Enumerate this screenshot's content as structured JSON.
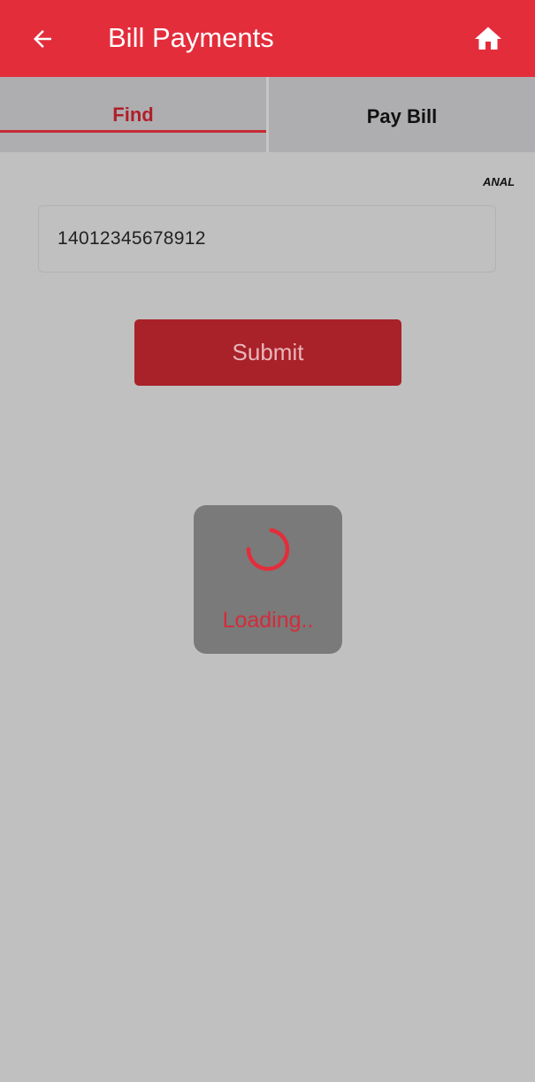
{
  "header": {
    "title": "Bill Payments",
    "back_icon": "arrow-left-icon",
    "home_icon": "home-icon"
  },
  "tabs": [
    {
      "label": "Find",
      "active": true
    },
    {
      "label": "Pay Bill",
      "active": false
    }
  ],
  "corner_text": "ANAL",
  "form": {
    "input_value": "14012345678912",
    "submit_label": "Submit"
  },
  "loading": {
    "text": "Loading..",
    "icon": "spinner-icon"
  },
  "colors": {
    "brand": "#e32d3b",
    "accent": "#b01f2a",
    "button": "#a92129",
    "background": "#c0c0c0",
    "tab_bar": "#aeaeb0",
    "overlay": "#7a7a7a"
  }
}
